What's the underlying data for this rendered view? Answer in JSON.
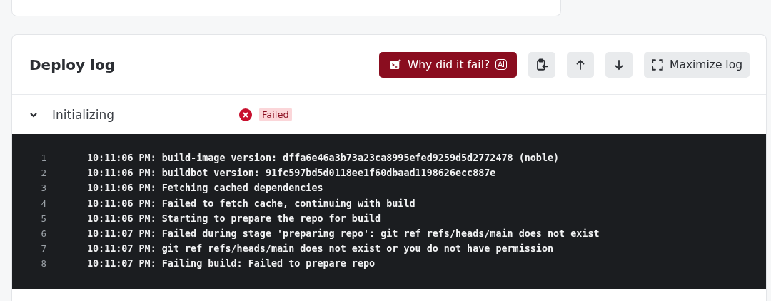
{
  "deploy_log": {
    "title": "Deploy log",
    "toolbar": [
      {
        "kind": "ai",
        "label": "Why did it fail?",
        "badge": "AI"
      },
      {
        "kind": "copy"
      },
      {
        "kind": "up"
      },
      {
        "kind": "down"
      },
      {
        "kind": "maximize",
        "label": "Maximize log"
      }
    ],
    "step": {
      "name": "Initializing",
      "expanded": true,
      "status": {
        "kind": "failed",
        "label": "Failed"
      }
    },
    "lines": [
      {
        "number": "1",
        "text": "10:11:06 PM: build-image version: dffa6e46a3b73a23ca8995efed9259d5d2772478 (noble)"
      },
      {
        "number": "2",
        "text": "10:11:06 PM: buildbot version: 91fc597bd5d0118ee1f60dbaad1198626ecc887e"
      },
      {
        "number": "3",
        "text": "10:11:06 PM: Fetching cached dependencies"
      },
      {
        "number": "4",
        "text": "10:11:06 PM: Failed to fetch cache, continuing with build"
      },
      {
        "number": "5",
        "text": "10:11:06 PM: Starting to prepare the repo for build"
      },
      {
        "number": "6",
        "text": "10:11:07 PM: Failed during stage 'preparing repo': git ref refs/heads/main does not exist"
      },
      {
        "number": "7",
        "text": "10:11:07 PM: git ref refs/heads/main does not exist or you do not have permission"
      },
      {
        "number": "8",
        "text": "10:11:07 PM: Failing build: Failed to prepare repo"
      }
    ]
  }
}
